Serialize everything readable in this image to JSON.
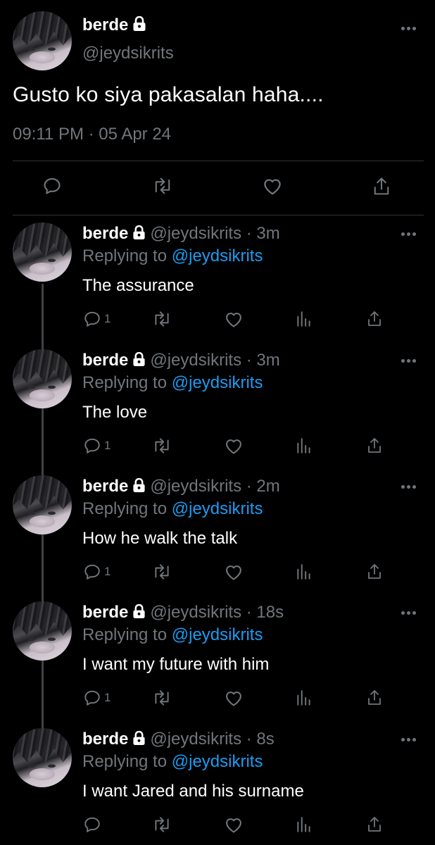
{
  "main_tweet": {
    "name": "berde",
    "handle": "@jeydsikrits",
    "text": "Gusto ko siya pakasalan haha....",
    "timestamp": "09:11 PM · 05 Apr 24"
  },
  "replies": [
    {
      "name": "berde",
      "handle_time": "@jeydsikrits · 3m",
      "replying_prefix": "Replying to",
      "replying_to": "@jeydsikrits",
      "text": "The assurance",
      "reply_count": "1"
    },
    {
      "name": "berde",
      "handle_time": "@jeydsikrits · 3m",
      "replying_prefix": "Replying to",
      "replying_to": "@jeydsikrits",
      "text": "The love",
      "reply_count": "1"
    },
    {
      "name": "berde",
      "handle_time": "@jeydsikrits · 2m",
      "replying_prefix": "Replying to",
      "replying_to": "@jeydsikrits",
      "text": "How he walk the talk",
      "reply_count": "1"
    },
    {
      "name": "berde",
      "handle_time": "@jeydsikrits · 18s",
      "replying_prefix": "Replying to",
      "replying_to": "@jeydsikrits",
      "text": "I want my future with him",
      "reply_count": "1"
    },
    {
      "name": "berde",
      "handle_time": "@jeydsikrits · 8s",
      "replying_prefix": "Replying to",
      "replying_to": "@jeydsikrits",
      "text": "I want Jared and his surname",
      "reply_count": ""
    }
  ],
  "colors": {
    "background": "#000000",
    "text_primary": "#ffffff",
    "text_secondary": "#71767b",
    "link": "#1d9bf0",
    "divider": "#2f3336"
  },
  "icons": [
    "lock-icon",
    "more-icon",
    "reply-icon",
    "retweet-icon",
    "like-icon",
    "views-icon",
    "share-icon"
  ]
}
